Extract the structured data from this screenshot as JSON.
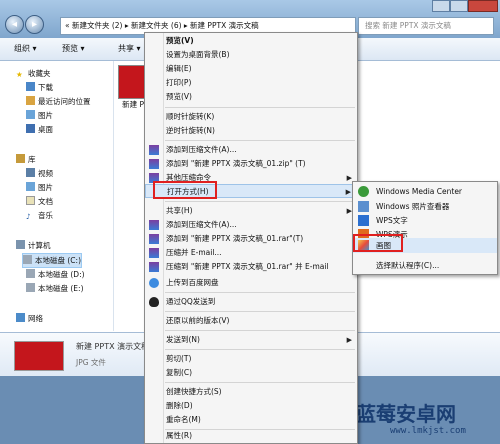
{
  "window": {
    "breadcrumb": "« 新建文件夹 (2) ▸ 新建文件夹 (6) ▸ 新建 PPTX 演示文稿",
    "search_placeholder": "搜索 新建 PPTX 演示文稿"
  },
  "toolbar": {
    "organize": "组织 ▾",
    "preview": "预览 ▾",
    "share": "共享 ▾"
  },
  "sidebar": {
    "favorites": "收藏夹",
    "downloads": "下载",
    "recent": "最近访问的位置",
    "pictures": "图片",
    "desktop": "桌面",
    "libraries": "库",
    "videos": "视频",
    "lib_pictures": "图片",
    "documents": "文档",
    "music": "音乐",
    "computer": "计算机",
    "drive_c": "本地磁盘 (C:)",
    "drive_d": "本地磁盘 (D:)",
    "drive_e": "本地磁盘 (E:)",
    "network": "网络"
  },
  "file": {
    "thumb_label": "新建 P 文"
  },
  "details": {
    "name": "新建 PPTX 演示文稿",
    "type": "JPG 文件"
  },
  "context_menu": {
    "items": [
      "预览(V)",
      "设置为桌面背景(B)",
      "编辑(E)",
      "打印(P)",
      "预览(V)",
      "顺时针旋转(K)",
      "逆时针旋转(N)",
      "添加到压缩文件(A)...",
      "添加到 \"新建 PPTX 演示文稿_01.zip\" (T)",
      "其他压缩命令",
      "打开方式(H)",
      "共享(H)",
      "添加到压缩文件(A)...",
      "添加到 \"新建 PPTX 演示文稿_01.rar\"(T)",
      "压缩并 E-mail...",
      "压缩到 \"新建 PPTX 演示文稿_01.rar\" 并 E-mail",
      "上传到百度网盘",
      "通过QQ发送到",
      "还原以前的版本(V)",
      "发送到(N)",
      "剪切(T)",
      "复制(C)",
      "创建快捷方式(S)",
      "删除(D)",
      "重命名(M)",
      "属性(R)"
    ]
  },
  "submenu": {
    "items": [
      "Windows Media Center",
      "Windows 照片查看器",
      "WPS文字",
      "WPS演示",
      "画图",
      "选择默认程序(C)..."
    ]
  },
  "watermark": {
    "title": "蓝莓安卓网",
    "url": "www.lmkjst.com"
  }
}
